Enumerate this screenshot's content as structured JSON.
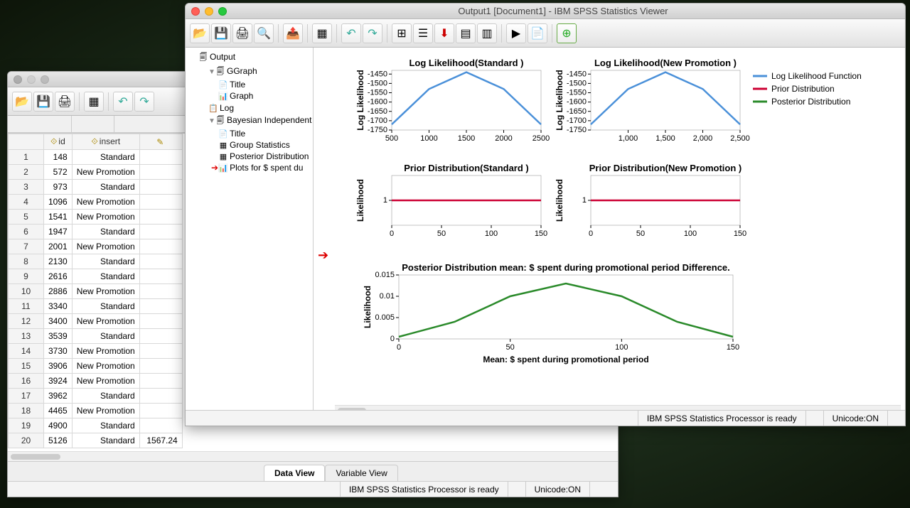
{
  "viewer": {
    "title": "Output1 [Document1] - IBM SPSS Statistics Viewer",
    "status_processor": "IBM SPSS Statistics Processor is ready",
    "status_unicode": "Unicode:ON",
    "outline": {
      "root": "Output",
      "ggraph": "GGraph",
      "gg_title": "Title",
      "gg_graph": "Graph",
      "log": "Log",
      "bayes": "Bayesian Independent",
      "b_title": "Title",
      "b_group": "Group Statistics",
      "b_post": "Posterior Distribution",
      "b_plots": "Plots for $ spent du"
    },
    "legend": {
      "ll": "Log Likelihood Function",
      "prior": "Prior Distribution",
      "post": "Posterior Distribution"
    }
  },
  "editor": {
    "status_processor": "IBM SPSS Statistics Processor is ready",
    "status_unicode": "Unicode:ON",
    "tab_data": "Data View",
    "tab_var": "Variable View",
    "cols": {
      "id": "id",
      "insert": "insert"
    },
    "rows": [
      {
        "n": 1,
        "id": 148,
        "insert": "Standard"
      },
      {
        "n": 2,
        "id": 572,
        "insert": "New Promotion"
      },
      {
        "n": 3,
        "id": 973,
        "insert": "Standard"
      },
      {
        "n": 4,
        "id": 1096,
        "insert": "New Promotion"
      },
      {
        "n": 5,
        "id": 1541,
        "insert": "New Promotion"
      },
      {
        "n": 6,
        "id": 1947,
        "insert": "Standard"
      },
      {
        "n": 7,
        "id": 2001,
        "insert": "New Promotion"
      },
      {
        "n": 8,
        "id": 2130,
        "insert": "Standard"
      },
      {
        "n": 9,
        "id": 2616,
        "insert": "Standard"
      },
      {
        "n": 10,
        "id": 2886,
        "insert": "New Promotion"
      },
      {
        "n": 11,
        "id": 3340,
        "insert": "Standard"
      },
      {
        "n": 12,
        "id": 3400,
        "insert": "New Promotion"
      },
      {
        "n": 13,
        "id": 3539,
        "insert": "Standard"
      },
      {
        "n": 14,
        "id": 3730,
        "insert": "New Promotion"
      },
      {
        "n": 15,
        "id": 3906,
        "insert": "New Promotion"
      },
      {
        "n": 16,
        "id": 3924,
        "insert": "New Promotion"
      },
      {
        "n": 17,
        "id": 3962,
        "insert": "Standard"
      },
      {
        "n": 18,
        "id": 4465,
        "insert": "New Promotion"
      },
      {
        "n": 19,
        "id": 4900,
        "insert": "Standard"
      },
      {
        "n": 20,
        "id": 5126,
        "insert": "Standard"
      }
    ],
    "extra_cell": "1567.24"
  },
  "chart_data": [
    {
      "type": "line",
      "title": "Log Likelihood(Standard )",
      "xlabel": "",
      "ylabel": "Log Likelihood",
      "x": [
        500,
        1000,
        1500,
        2000,
        2500
      ],
      "y": [
        -1720,
        -1530,
        -1440,
        -1530,
        -1720
      ],
      "x_ticks": [
        500,
        1000,
        1500,
        2000,
        2500
      ],
      "y_ticks": [
        -1450,
        -1500,
        -1550,
        -1600,
        -1650,
        -1700,
        -1750
      ],
      "ylim": [
        -1750,
        -1430
      ],
      "series_name": "Log Likelihood Function",
      "color": "#4a90d9"
    },
    {
      "type": "line",
      "title": "Log Likelihood(New Promotion )",
      "xlabel": "",
      "ylabel": "Log Likelihood",
      "x": [
        500,
        1000,
        1500,
        2000,
        2500
      ],
      "y": [
        -1720,
        -1530,
        -1440,
        -1530,
        -1720
      ],
      "x_ticks": [
        "1,000",
        "1,500",
        "2,000",
        "2,500"
      ],
      "y_ticks": [
        -1450,
        -1500,
        -1550,
        -1600,
        -1650,
        -1700,
        -1750
      ],
      "ylim": [
        -1750,
        -1430
      ],
      "series_name": "Log Likelihood Function",
      "color": "#4a90d9"
    },
    {
      "type": "line",
      "title": "Prior Distribution(Standard )",
      "xlabel": "",
      "ylabel": "Likelihood",
      "x": [
        0,
        50,
        100,
        150
      ],
      "y": [
        1,
        1,
        1,
        1
      ],
      "x_ticks": [
        0,
        50,
        100,
        150
      ],
      "y_ticks": [
        1
      ],
      "series_name": "Prior Distribution",
      "color": "#cc0033"
    },
    {
      "type": "line",
      "title": "Prior Distribution(New Promotion )",
      "xlabel": "",
      "ylabel": "Likelihood",
      "x": [
        0,
        50,
        100,
        150
      ],
      "y": [
        1,
        1,
        1,
        1
      ],
      "x_ticks": [
        0,
        50,
        100,
        150
      ],
      "y_ticks": [
        1
      ],
      "series_name": "Prior Distribution",
      "color": "#cc0033"
    },
    {
      "type": "line",
      "title": "Posterior Distribution mean: $ spent during promotional period Difference.",
      "xlabel": "Mean: $ spent during promotional period",
      "ylabel": "Likelihood",
      "x": [
        0,
        25,
        50,
        75,
        100,
        125,
        150
      ],
      "y": [
        0.0005,
        0.004,
        0.01,
        0.013,
        0.01,
        0.004,
        0.0005
      ],
      "x_ticks": [
        0,
        50,
        100,
        150
      ],
      "y_ticks": [
        0.0,
        0.005,
        0.01,
        0.015
      ],
      "ylim": [
        0,
        0.015
      ],
      "series_name": "Posterior Distribution",
      "color": "#2a8a2a"
    }
  ]
}
